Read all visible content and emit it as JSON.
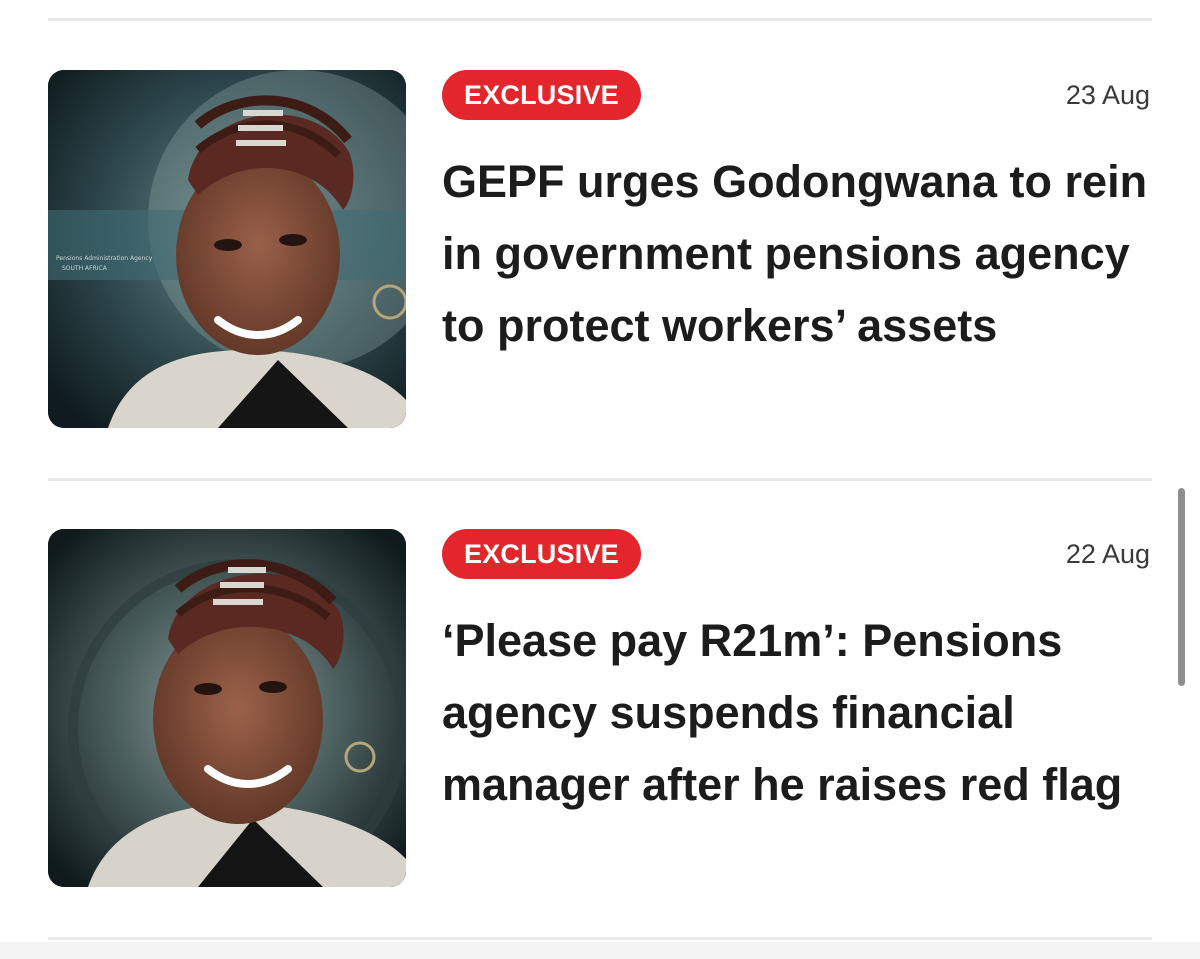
{
  "articles": [
    {
      "badge": "EXCLUSIVE",
      "date": "23 Aug",
      "headline": "GEPF urges Godongwana to rein in government pensions agency to protect workers’ assets",
      "image_caption": "Pensions Administration Agency SOUTH AFRICA"
    },
    {
      "badge": "EXCLUSIVE",
      "date": "22 Aug",
      "headline": "‘Please pay R21m’: Pensions agency suspends financial manager after he raises red flag"
    }
  ],
  "colors": {
    "badge": "#e3262b",
    "headline": "#1c1c1c",
    "date": "#3a3a3a",
    "divider": "#e8e8e8"
  }
}
